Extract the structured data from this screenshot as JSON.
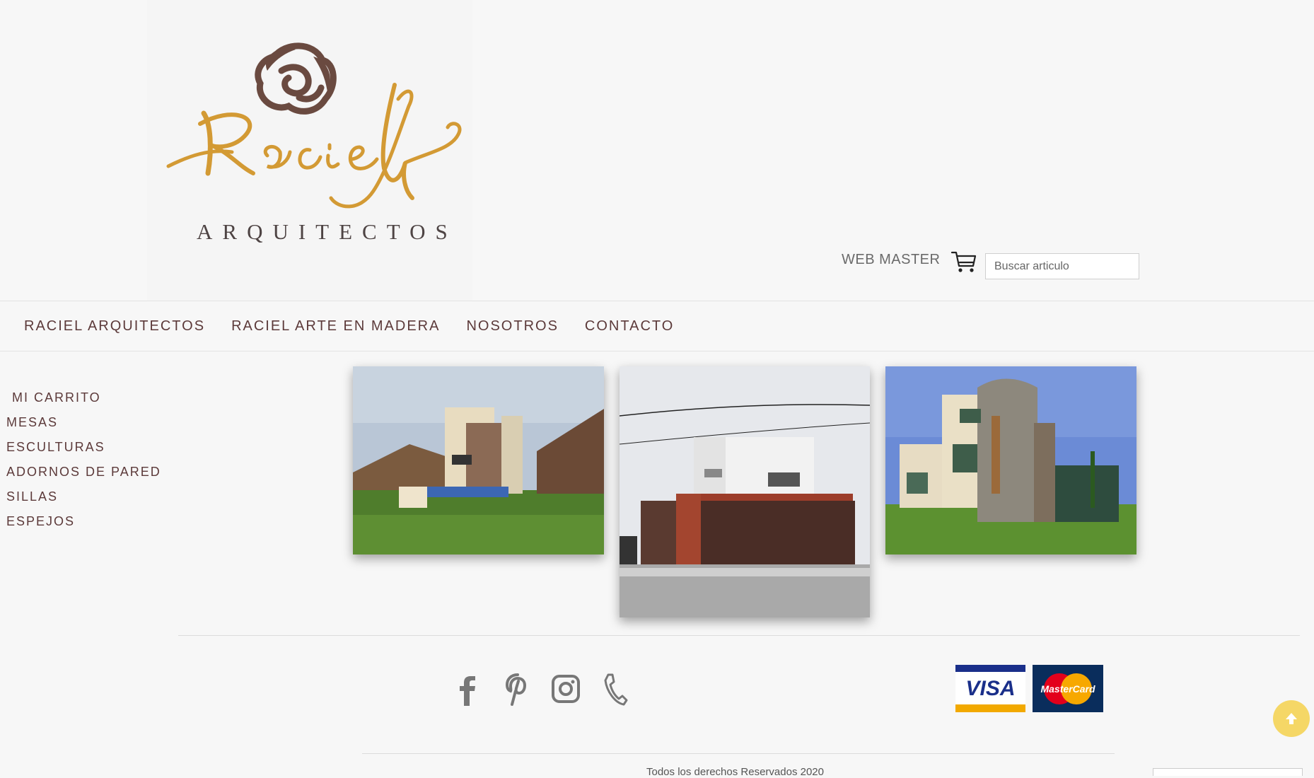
{
  "brand": {
    "name_script": "Raciel",
    "name_sub": "ARQUITECTOS",
    "colors": {
      "script": "#d39a34",
      "mark": "#6a4a40",
      "text": "#4e4444"
    }
  },
  "header": {
    "webmaster_label": "WEB MASTER",
    "cart_icon": "shopping-cart-icon",
    "search": {
      "placeholder": "Buscar articulo",
      "value": ""
    }
  },
  "nav": {
    "items": [
      {
        "label": "RACIEL ARQUITECTOS"
      },
      {
        "label": "RACIEL ARTE EN MADERA"
      },
      {
        "label": "NOSOTROS"
      },
      {
        "label": "CONTACTO"
      }
    ]
  },
  "sidebar": {
    "items": [
      {
        "label": "MI CARRITO"
      },
      {
        "label": "MESAS"
      },
      {
        "label": "ESCULTURAS"
      },
      {
        "label": "ADORNOS DE PARED"
      },
      {
        "label": "SILLAS"
      },
      {
        "label": "ESPEJOS"
      }
    ]
  },
  "footer": {
    "social_icons": [
      "facebook-icon",
      "pinterest-icon",
      "instagram-icon",
      "phone-icon"
    ],
    "payment": {
      "visa": "VISA",
      "mastercard": "MasterCard"
    },
    "copyright": "Todos los derechos Reservados 2020"
  },
  "accent": {
    "to_top": "#f5d766",
    "nav_text": "#5c3a3a"
  }
}
